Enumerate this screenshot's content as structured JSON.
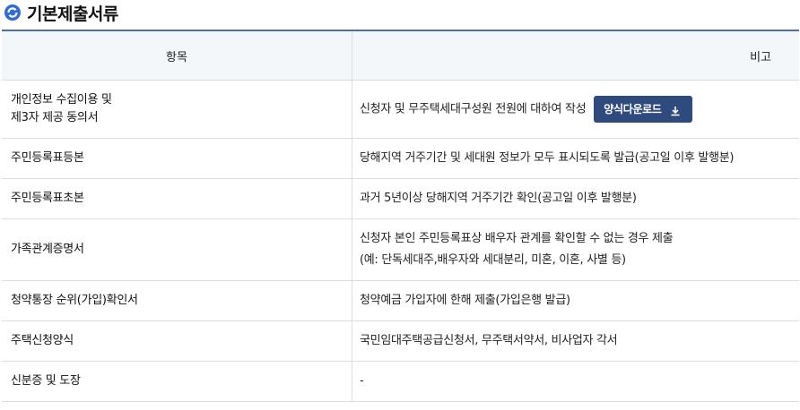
{
  "section": {
    "title": "기본제출서류"
  },
  "table": {
    "headers": {
      "item": "항목",
      "note": "비고"
    },
    "rows": [
      {
        "item_line1": "개인정보 수집이용 및",
        "item_line2": "제3자 제공 동의서",
        "note": "신청자 및 무주택세대구성원 전원에 대하여 작성",
        "button": "양식다운로드"
      },
      {
        "item": "주민등록표등본",
        "note": "당해지역 거주기간 및 세대원 정보가 모두 표시되도록 발급(공고일 이후 발행분)"
      },
      {
        "item": "주민등록표초본",
        "note": "과거 5년이상 당해지역 거주기간 확인(공고일 이후 발행분)"
      },
      {
        "item": "가족관계증명서",
        "note_line1": "신청자 본인 주민등록표상 배우자 관계를 확인할 수 없는 경우 제출",
        "note_line2": "(예: 단독세대주,배우자와 세대분리, 미혼, 이혼, 사별 등)"
      },
      {
        "item": "청약통장 순위(가입)확인서",
        "note": "청약예금 가입자에 한해 제출(가입은행 발급)"
      },
      {
        "item": "주택신청양식",
        "note": "국민임대주택공급신청서, 무주택서약서, 비사업자 각서"
      },
      {
        "item": "신분증 및 도장",
        "note": "-"
      }
    ]
  },
  "colors": {
    "accent": "#4d6fa3",
    "button_bg": "#2f4a7c",
    "header_bg": "#f3f7fa",
    "icon_blue": "#2f6bd8"
  }
}
